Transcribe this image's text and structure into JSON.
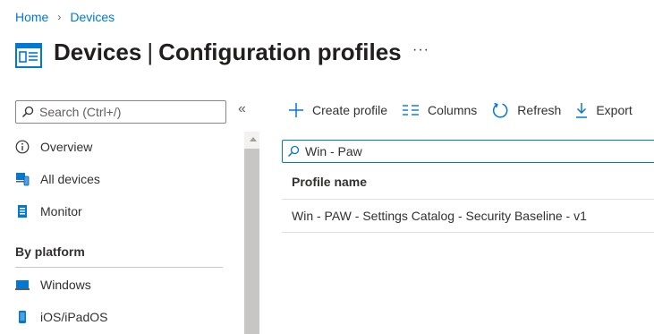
{
  "breadcrumb": {
    "home": "Home",
    "separator": "›",
    "current": "Devices"
  },
  "header": {
    "title_bold": "Devices",
    "title_separator": "|",
    "title_rest": "Configuration profiles",
    "more": "···",
    "icon": "profile-card-icon"
  },
  "sidebar": {
    "search_placeholder": "Search (Ctrl+/)",
    "collapse": "«",
    "items": [
      {
        "label": "Overview",
        "icon": "info-icon"
      },
      {
        "label": "All devices",
        "icon": "devices-icon"
      },
      {
        "label": "Monitor",
        "icon": "monitor-icon"
      }
    ],
    "section": "By platform",
    "platform_items": [
      {
        "label": "Windows",
        "icon": "windows-laptop-icon"
      },
      {
        "label": "iOS/iPadOS",
        "icon": "mobile-phone-icon"
      }
    ]
  },
  "toolbar": {
    "create": "Create profile",
    "columns": "Columns",
    "refresh": "Refresh",
    "export": "Export"
  },
  "filter": {
    "value": "Win - Paw"
  },
  "table": {
    "columns": [
      "Profile name"
    ],
    "rows": [
      {
        "name": "Win - PAW - Settings Catalog - Security Baseline - v1"
      }
    ]
  },
  "colors": {
    "accent": "#0078d4",
    "text": "#323130",
    "border": "#8a8886"
  }
}
